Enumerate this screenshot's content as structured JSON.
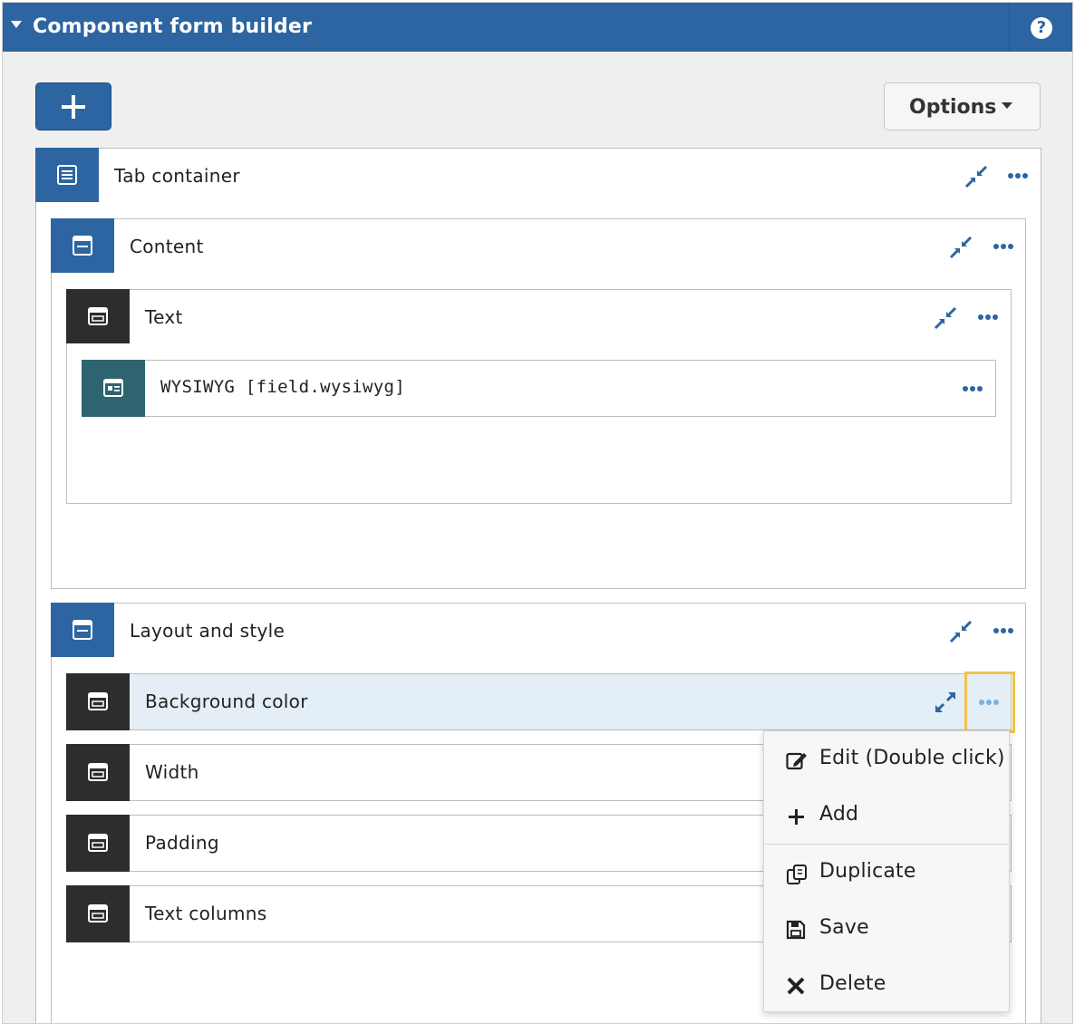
{
  "header": {
    "title": "Component form builder",
    "help": "?"
  },
  "toolbar": {
    "options_label": "Options"
  },
  "tree": {
    "tab_container": "Tab container",
    "content": "Content",
    "text": "Text",
    "wysiwyg": "WYSIWYG [field.wysiwyg]",
    "layout_style": "Layout and style",
    "background_color": "Background color",
    "width": "Width",
    "padding": "Padding",
    "text_columns": "Text columns"
  },
  "context_menu": {
    "edit": "Edit (Double click)",
    "add": "Add",
    "duplicate": "Duplicate",
    "save": "Save",
    "delete": "Delete"
  },
  "colors": {
    "primary": "#2c65a2",
    "dark_icon": "#2d2d2d",
    "field_icon": "#2d6470",
    "selected_row": "#e3eef6",
    "focus_ring": "#f0c24a"
  }
}
